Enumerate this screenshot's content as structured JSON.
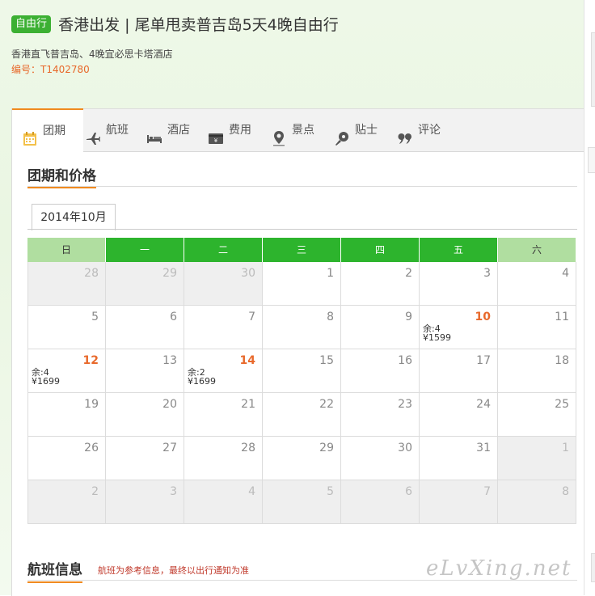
{
  "header": {
    "badge": "自由行",
    "title": "香港出发 | 尾单甩卖普吉岛5天4晚自由行",
    "subtitle": "香港直飞普吉岛、4晚宜必思卡塔酒店",
    "code": "编号：T1402780"
  },
  "tabs": [
    {
      "label": "团期",
      "icon": "calendar-icon",
      "active": true
    },
    {
      "label": "航班",
      "icon": "plane-icon",
      "active": false
    },
    {
      "label": "酒店",
      "icon": "bed-icon",
      "active": false
    },
    {
      "label": "费用",
      "icon": "wallet-icon",
      "active": false
    },
    {
      "label": "景点",
      "icon": "location-pin-icon",
      "active": false
    },
    {
      "label": "贴士",
      "icon": "pin-icon",
      "active": false
    },
    {
      "label": "评论",
      "icon": "quote-icon",
      "active": false
    }
  ],
  "section": {
    "title": "团期和价格"
  },
  "calendar": {
    "month_tab": "2014年10月",
    "weekdays": [
      "日",
      "一",
      "二",
      "三",
      "四",
      "五",
      "六"
    ],
    "rows": [
      [
        {
          "d": "28",
          "off": true
        },
        {
          "d": "29",
          "off": true
        },
        {
          "d": "30",
          "off": true
        },
        {
          "d": "1"
        },
        {
          "d": "2"
        },
        {
          "d": "3"
        },
        {
          "d": "4"
        }
      ],
      [
        {
          "d": "5"
        },
        {
          "d": "6"
        },
        {
          "d": "7"
        },
        {
          "d": "8"
        },
        {
          "d": "9"
        },
        {
          "d": "10",
          "rem": "余:4",
          "price": "¥1599"
        },
        {
          "d": "11"
        }
      ],
      [
        {
          "d": "12",
          "rem": "余:4",
          "price": "¥1699"
        },
        {
          "d": "13"
        },
        {
          "d": "14",
          "rem": "余:2",
          "price": "¥1699"
        },
        {
          "d": "15"
        },
        {
          "d": "16"
        },
        {
          "d": "17"
        },
        {
          "d": "18"
        }
      ],
      [
        {
          "d": "19"
        },
        {
          "d": "20"
        },
        {
          "d": "21"
        },
        {
          "d": "22"
        },
        {
          "d": "23"
        },
        {
          "d": "24"
        },
        {
          "d": "25"
        }
      ],
      [
        {
          "d": "26"
        },
        {
          "d": "27"
        },
        {
          "d": "28"
        },
        {
          "d": "29"
        },
        {
          "d": "30"
        },
        {
          "d": "31"
        },
        {
          "d": "1",
          "off": true
        }
      ],
      [
        {
          "d": "2",
          "off": true
        },
        {
          "d": "3",
          "off": true
        },
        {
          "d": "4",
          "off": true
        },
        {
          "d": "5",
          "off": true
        },
        {
          "d": "6",
          "off": true
        },
        {
          "d": "7",
          "off": true
        },
        {
          "d": "8",
          "off": true
        }
      ]
    ]
  },
  "flight": {
    "title": "航班信息",
    "note": "航班为参考信息，最终以出行通知为准"
  },
  "watermark": "eLvXing.net",
  "colors": {
    "accent_green": "#2db42d",
    "accent_orange": "#f08a1f",
    "highlight": "#e8692b"
  }
}
